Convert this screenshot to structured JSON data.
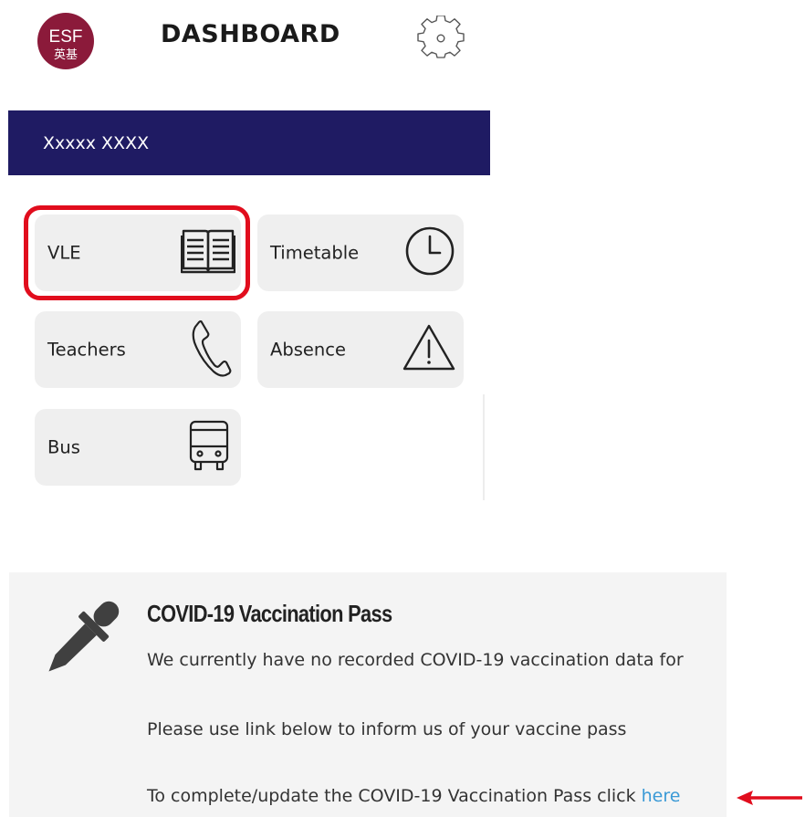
{
  "header": {
    "logo_text": "ESF",
    "logo_subtext": "英基",
    "title": "DASHBOARD",
    "settings_icon": "gear-icon"
  },
  "user": {
    "name": "Xxxxx XXXX"
  },
  "tiles": [
    {
      "label": "VLE",
      "icon": "book-icon"
    },
    {
      "label": "Timetable",
      "icon": "clock-icon"
    },
    {
      "label": "Teachers",
      "icon": "phone-icon"
    },
    {
      "label": "Absence",
      "icon": "warning-icon"
    },
    {
      "label": "Bus",
      "icon": "bus-icon"
    }
  ],
  "covid": {
    "icon": "dropper-icon",
    "title": "COVID-19 Vaccination Pass",
    "line1": "We currently have no recorded COVID-19 vaccination data for",
    "line2": "Please use link below to inform us of your vaccine pass",
    "line3_prefix": "To complete/update the COVID-19 Vaccination Pass click ",
    "link_text": "here"
  },
  "colors": {
    "banner": "#1f1b63",
    "logo": "#8b1a3a",
    "highlight": "#e10d1d",
    "link": "#3b9ad6",
    "tile_bg": "#efefef"
  }
}
